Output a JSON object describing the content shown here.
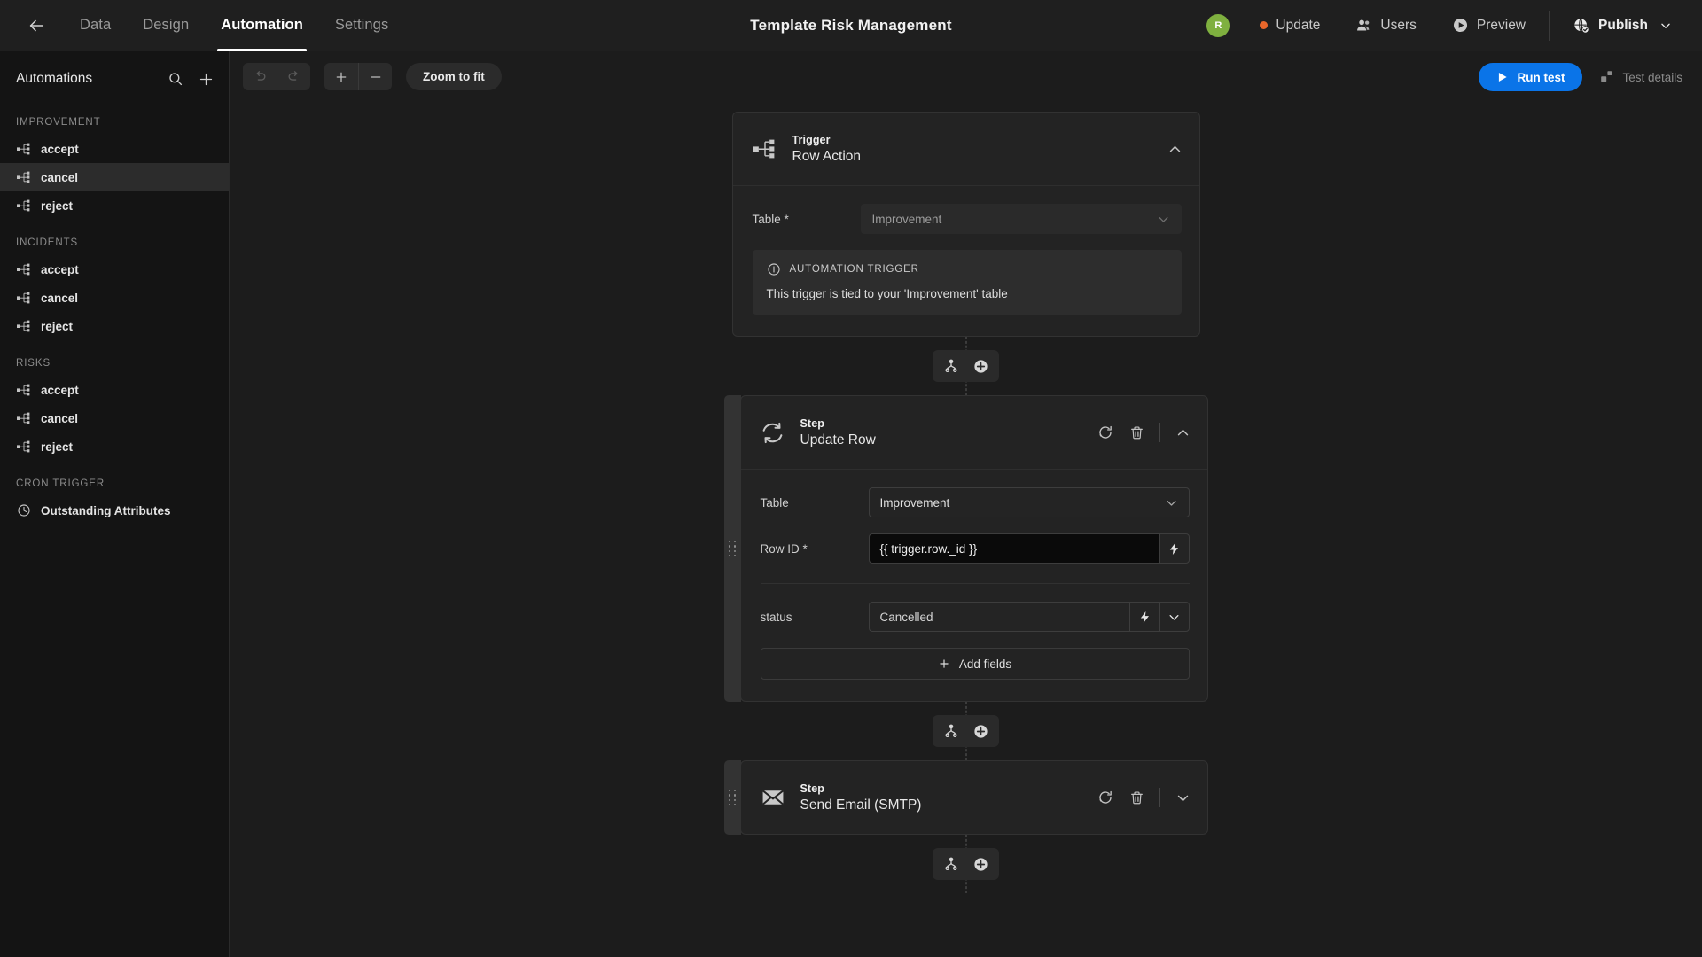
{
  "topbar": {
    "back_icon": "arrow-left-icon",
    "tabs": [
      {
        "label": "Data",
        "active": false
      },
      {
        "label": "Design",
        "active": false
      },
      {
        "label": "Automation",
        "active": true
      },
      {
        "label": "Settings",
        "active": false
      }
    ],
    "title": "Template Risk Management",
    "avatar_initial": "R",
    "avatar_color": "#7fb03f",
    "update_label": "Update",
    "update_dot_color": "#e8662a",
    "users_label": "Users",
    "preview_label": "Preview",
    "publish_label": "Publish"
  },
  "sidebar": {
    "title": "Automations",
    "search_icon": "search-icon",
    "add_icon": "plus-icon",
    "groups": [
      {
        "label": "IMPROVEMENT",
        "items": [
          {
            "label": "accept",
            "selected": false
          },
          {
            "label": "cancel",
            "selected": true
          },
          {
            "label": "reject",
            "selected": false
          }
        ]
      },
      {
        "label": "INCIDENTS",
        "items": [
          {
            "label": "accept",
            "selected": false
          },
          {
            "label": "cancel",
            "selected": false
          },
          {
            "label": "reject",
            "selected": false
          }
        ]
      },
      {
        "label": "RISKS",
        "items": [
          {
            "label": "accept",
            "selected": false
          },
          {
            "label": "cancel",
            "selected": false
          },
          {
            "label": "reject",
            "selected": false
          }
        ]
      },
      {
        "label": "CRON TRIGGER",
        "items": [
          {
            "label": "Outstanding Attributes",
            "selected": false,
            "icon": "clock-icon"
          }
        ]
      }
    ]
  },
  "toolbar": {
    "undo_icon": "undo-icon",
    "redo_icon": "redo-icon",
    "zoom_in_label": "+",
    "zoom_out_label": "−",
    "zoom_to_fit_label": "Zoom to fit",
    "run_test_label": "Run test",
    "run_test_color": "#0a74e8",
    "test_details_label": "Test details"
  },
  "flow": {
    "trigger": {
      "kind": "Trigger",
      "name": "Row Action",
      "icon": "flow-branch-icon",
      "collapse_icon": "chevron-up-icon",
      "table_label": "Table *",
      "table_value": "Improvement",
      "notice_title": "AUTOMATION TRIGGER",
      "notice_icon": "info-icon",
      "notice_body": "This trigger is tied to your 'Improvement' table"
    },
    "connector": {
      "branch_icon": "branch-node-icon",
      "add_icon": "plus-circle-icon"
    },
    "steps": [
      {
        "kind": "Step",
        "name": "Update Row",
        "icon": "refresh-cycle-icon",
        "rerun_icon": "rerun-icon",
        "delete_icon": "trash-icon",
        "collapse_icon": "chevron-up-icon",
        "expanded": true,
        "fields": [
          {
            "label": "Table",
            "type": "select",
            "value": "Improvement"
          },
          {
            "label": "Row ID *",
            "type": "binding",
            "value": "{{ trigger.row._id }}",
            "binding_icon": "lightning-icon"
          }
        ],
        "extra_fields": [
          {
            "label": "status",
            "type": "select-binding",
            "value": "Cancelled",
            "binding_icon": "lightning-icon",
            "chevron_icon": "chevron-down-icon"
          }
        ],
        "add_fields_label": "Add fields",
        "add_fields_icon": "plus-icon"
      },
      {
        "kind": "Step",
        "name": "Send Email (SMTP)",
        "icon": "envelope-icon",
        "rerun_icon": "rerun-icon",
        "delete_icon": "trash-icon",
        "collapse_icon": "chevron-down-icon",
        "expanded": false
      }
    ]
  }
}
